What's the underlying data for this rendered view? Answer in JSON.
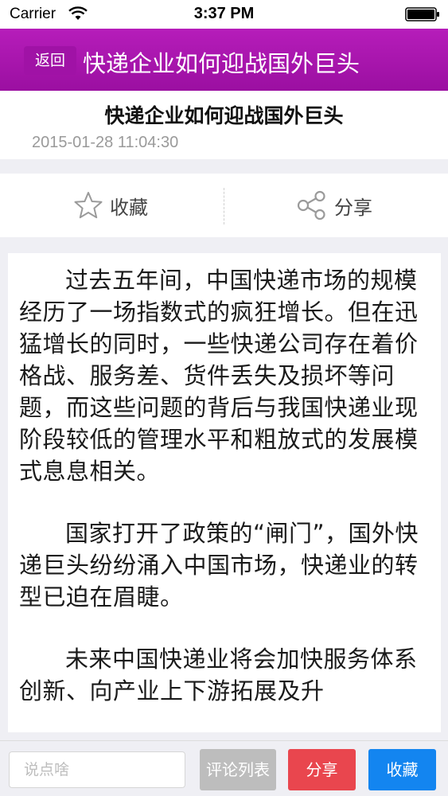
{
  "status_bar": {
    "carrier": "Carrier",
    "time": "3:37 PM",
    "icons": [
      "wifi-icon",
      "battery-icon"
    ]
  },
  "nav": {
    "back_label": "返回",
    "title": "快递企业如何迎战国外巨头",
    "color": "#a812ae"
  },
  "article": {
    "title": "快递企业如何迎战国外巨头",
    "date": "2015-01-28 11:04:30",
    "paragraphs": [
      "过去五年间，中国快递市场的规模经历了一场指数式的疯狂增长。但在迅猛增长的同时，一些快递公司存在着价格战、服务差、货件丢失及损坏等问题，而这些问题的背后与我国快递业现阶段较低的管理水平和粗放式的发展模式息息相关。",
      "国家打开了政策的“闸门”，国外快递巨头纷纷涌入中国市场，快递业的转型已迫在眉睫。",
      "未来中国快递业将会加快服务体系创新、向产业上下游拓展及升"
    ]
  },
  "actions": {
    "favorite_label": "收藏",
    "favorite_icon": "star-outline-icon",
    "share_label": "分享",
    "share_icon": "share-icon"
  },
  "bottom_bar": {
    "input_placeholder": "说点啥",
    "comments_label": "评论列表",
    "share_label": "分享",
    "favorite_label": "收藏",
    "colors": {
      "comments": "#bdbdbd",
      "share": "#e9464e",
      "favorite": "#1385f0"
    }
  }
}
